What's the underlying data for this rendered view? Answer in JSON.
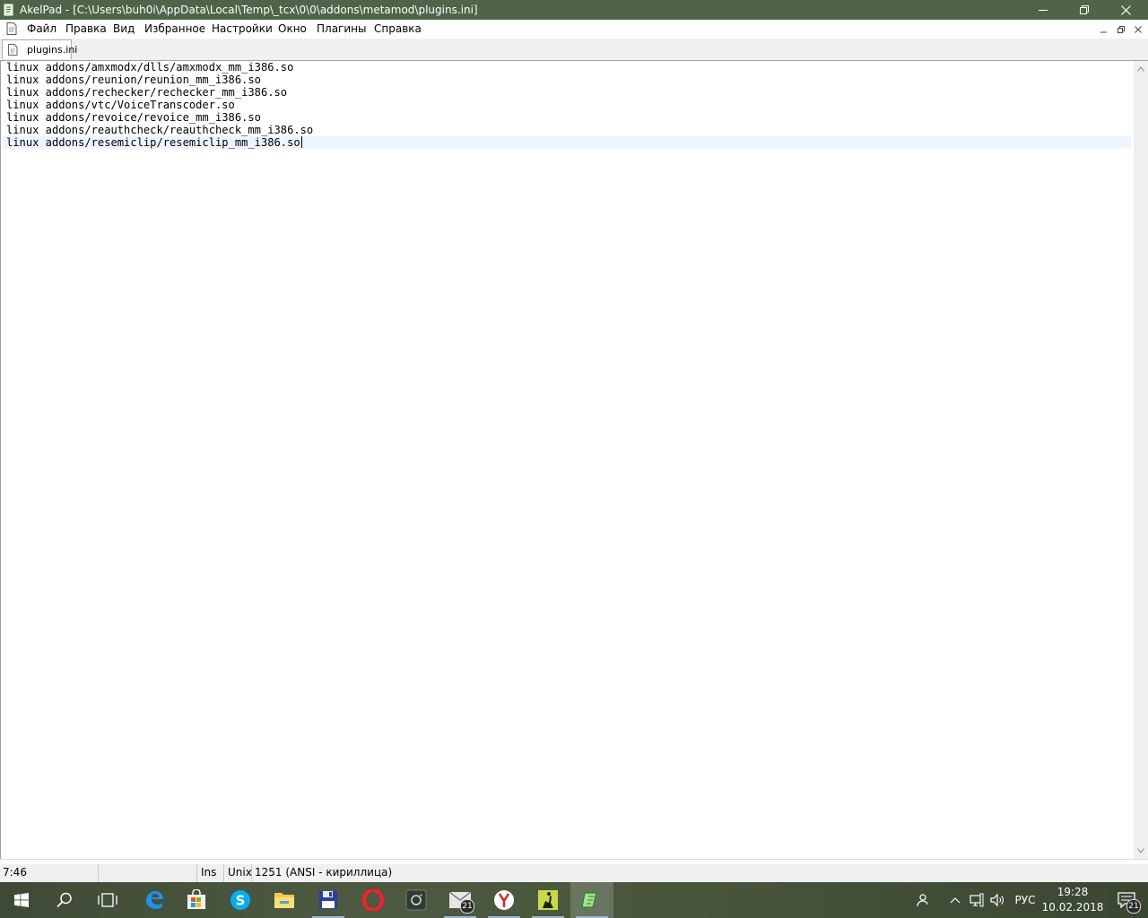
{
  "window": {
    "title": "AkelPad - [C:\\Users\\buh0i\\AppData\\Local\\Temp\\_tcx\\0\\0\\addons\\metamod\\plugins.ini]"
  },
  "menu": {
    "items": [
      "Файл",
      "Правка",
      "Вид",
      "Избранное",
      "Настройки",
      "Окно",
      "Плагины",
      "Справка"
    ]
  },
  "tabs": [
    {
      "label": "plugins.ini"
    }
  ],
  "editor": {
    "lines": [
      "linux addons/amxmodx/dlls/amxmodx_mm_i386.so",
      "linux addons/reunion/reunion_mm_i386.so",
      "linux addons/rechecker/rechecker_mm_i386.so",
      "linux addons/vtc/VoiceTranscoder.so",
      "linux addons/revoice/revoice_mm_i386.so",
      "linux addons/reauthcheck/reauthcheck_mm_i386.so",
      "linux addons/resemiclip/resemiclip_mm_i386.so"
    ]
  },
  "status": {
    "position": "7:46",
    "insert_mode": "Ins",
    "newline": "Unix",
    "codepage": "1251  (ANSI - кириллица)"
  },
  "taskbar": {
    "apps": [
      {
        "icon": "windows-start-icon"
      },
      {
        "icon": "search-icon"
      },
      {
        "icon": "task-view-icon"
      },
      {
        "icon": "edge-browser-icon"
      },
      {
        "icon": "store-icon"
      },
      {
        "icon": "skype-icon"
      },
      {
        "icon": "file-explorer-icon"
      },
      {
        "icon": "floppy-disk-icon"
      },
      {
        "icon": "opera-browser-icon"
      },
      {
        "icon": "camera-app-icon"
      },
      {
        "icon": "mail-icon",
        "badge": "21"
      },
      {
        "icon": "yandex-browser-icon"
      },
      {
        "icon": "counter-strike-icon"
      },
      {
        "icon": "akelpad-icon"
      }
    ],
    "tray": {
      "language": "РУС",
      "time": "19:28",
      "date": "10.02.2018",
      "notifications_badge": "21"
    }
  },
  "colors": {
    "titlebar": "#4f6448",
    "current_line": "#eef4fb",
    "taskbar": "#48563c"
  }
}
